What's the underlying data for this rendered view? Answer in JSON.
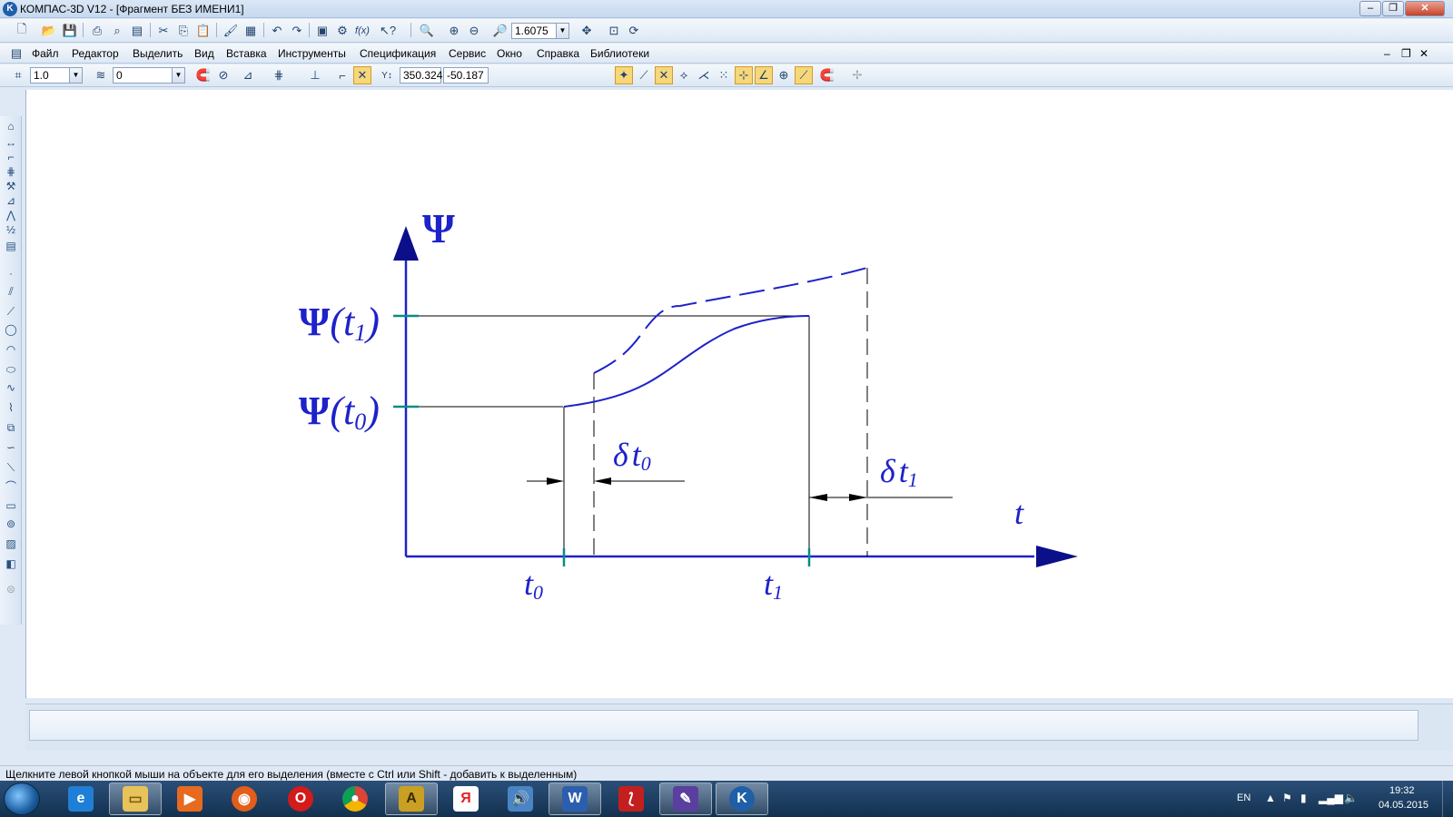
{
  "window": {
    "title": "КОМПАС-3D V12 - [Фрагмент БЕЗ ИМЕНИ1]",
    "app_icon": "kompas-logo-icon"
  },
  "toolbar_main": {
    "zoom_value": "1.6075"
  },
  "menubar": {
    "items": [
      "Файл",
      "Редактор",
      "Выделить",
      "Вид",
      "Вставка",
      "Инструменты",
      "Спецификация",
      "Сервис",
      "Окно",
      "Справка",
      "Библиотеки"
    ]
  },
  "toolbar_current": {
    "step_value": "1.0",
    "layer_value": "0",
    "coord_x": "350.324",
    "coord_y": "-50.187"
  },
  "drawing": {
    "y_axis_label": "Ψ",
    "x_axis_label": "t",
    "psi_t1": {
      "psi": "Ψ",
      "arg": "(t",
      "sub": "1",
      "close": ")"
    },
    "psi_t0": {
      "psi": "Ψ",
      "arg": "(t",
      "sub": "0",
      "close": ")"
    },
    "t0": {
      "base": "t",
      "sub": "0"
    },
    "t1": {
      "base": "t",
      "sub": "1"
    },
    "delta_t0": {
      "delta": "δ",
      "base": "t",
      "sub": "0"
    },
    "delta_t1": {
      "delta": "δ",
      "base": "t",
      "sub": "1"
    },
    "colors": {
      "curve": "#1d22c9",
      "axis": "#1d22c9",
      "thin": "#000000",
      "tick": "#0a8a8a"
    }
  },
  "statusbar": {
    "hint": "Щелкните левой кнопкой мыши на объекте для его выделения (вместе с Ctrl или Shift - добавить к выделенным)"
  },
  "taskbar": {
    "tray": {
      "lang": "EN",
      "time": "19:32",
      "date": "04.05.2015"
    }
  }
}
